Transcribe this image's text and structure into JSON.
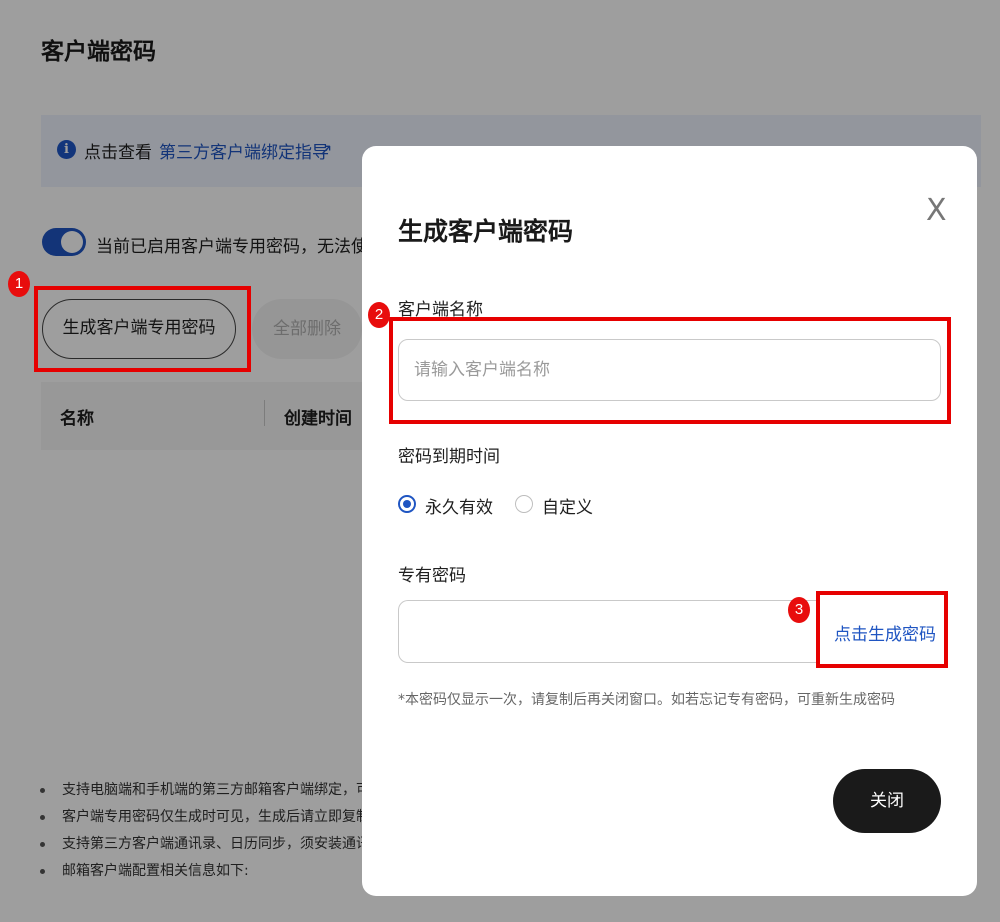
{
  "page": {
    "title": "客户端密码",
    "info": {
      "prefix": "点击查看",
      "link": "第三方客户端绑定指导",
      "icon": "info-icon",
      "external_icon": "external-link-icon"
    },
    "toggle": {
      "on": true,
      "text": "当前已启用客户端专用密码，无法使用"
    },
    "buttons": {
      "generate": "生成客户端专用密码",
      "delete_all": "全部删除"
    },
    "table": {
      "headers": [
        "名称",
        "创建时间"
      ]
    },
    "notes": [
      "支持电脑端和手机端的第三方邮箱客户端绑定，可这",
      "客户端专用密码仅生成时可见，生成后请立即复制。",
      "支持第三方客户端通讯录、日历同步，须安装通讯录",
      "邮箱客户端配置相关信息如下:"
    ]
  },
  "modal": {
    "title": "生成客户端密码",
    "close_icon": "X",
    "name_label": "客户端名称",
    "name_placeholder": "请输入客户端名称",
    "name_value": "",
    "expiry_label": "密码到期时间",
    "expiry_options": [
      "永久有效",
      "自定义"
    ],
    "expiry_selected": "永久有效",
    "password_label": "专有密码",
    "password_value": "",
    "generate_link": "点击生成密码",
    "note": "*本密码仅显示一次，请复制后再关闭窗口。如若忘记专有密码，可重新生成密码",
    "close_button": "关闭"
  },
  "annotations": {
    "step1": "1",
    "step2": "2",
    "step3": "3",
    "highlight_color": "#e60000"
  },
  "colors": {
    "accent": "#1f55c2",
    "overlay": "rgba(0,0,0,0.38)",
    "primary_dark": "#1a1a1a"
  }
}
